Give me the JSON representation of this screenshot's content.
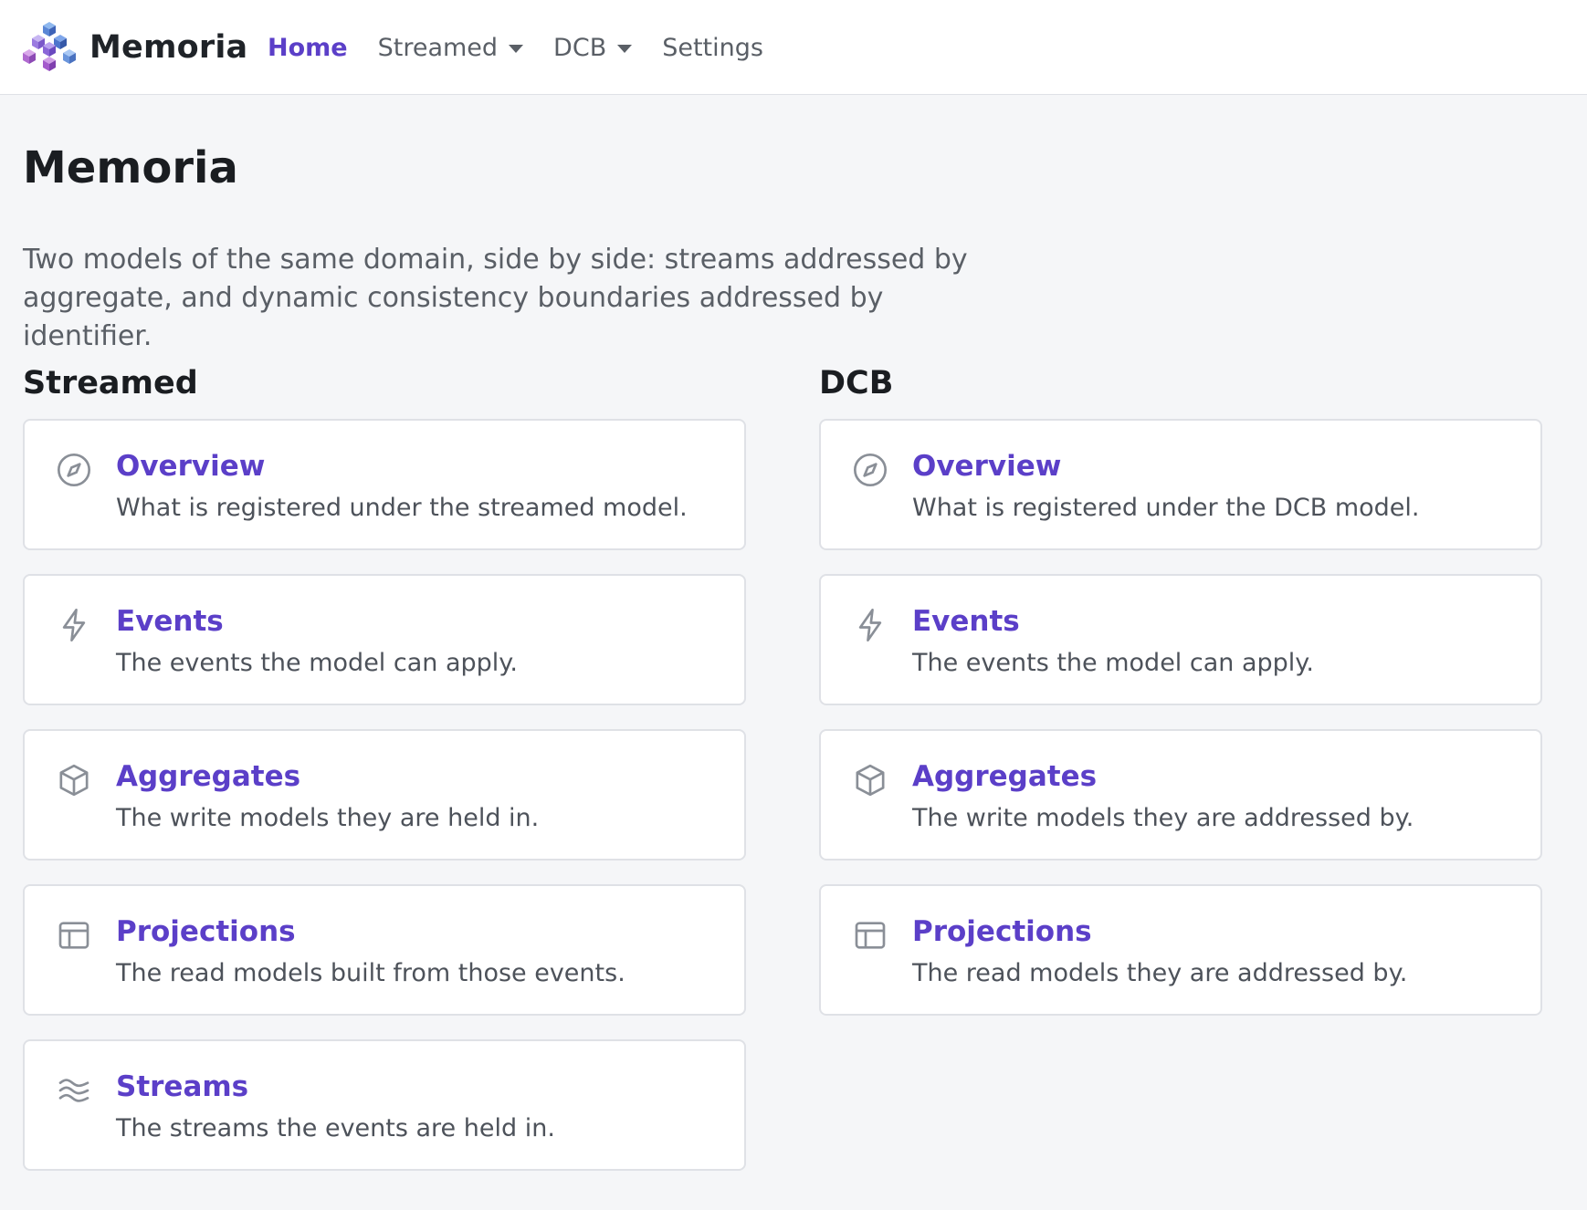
{
  "brand": {
    "name": "Memoria"
  },
  "nav": {
    "home": "Home",
    "streamed": "Streamed",
    "dcb": "DCB",
    "settings": "Settings"
  },
  "page": {
    "title": "Memoria",
    "intro": "Two models of the same domain, side by side: streams addressed by aggregate, and dynamic consistency boundaries addressed by identifier."
  },
  "streamed": {
    "title": "Streamed",
    "cards": [
      {
        "icon": "compass-icon",
        "title": "Overview",
        "description": "What is registered under the streamed model."
      },
      {
        "icon": "lightning-icon",
        "title": "Events",
        "description": "The events the model can apply."
      },
      {
        "icon": "cube-icon",
        "title": "Aggregates",
        "description": "The write models they are held in."
      },
      {
        "icon": "layout-icon",
        "title": "Projections",
        "description": "The read models built from those events."
      },
      {
        "icon": "waves-icon",
        "title": "Streams",
        "description": "The streams the events are held in."
      }
    ]
  },
  "dcb": {
    "title": "DCB",
    "cards": [
      {
        "icon": "compass-icon",
        "title": "Overview",
        "description": "What is registered under the DCB model."
      },
      {
        "icon": "lightning-icon",
        "title": "Events",
        "description": "The events the model can apply."
      },
      {
        "icon": "cube-icon",
        "title": "Aggregates",
        "description": "The write models they are addressed by."
      },
      {
        "icon": "layout-icon",
        "title": "Projections",
        "description": "The read models they are addressed by."
      }
    ]
  },
  "colors": {
    "accent": "#5b3fc8",
    "icon": "#8a8f97",
    "border": "#dfe1e6",
    "background": "#f5f6f8"
  }
}
